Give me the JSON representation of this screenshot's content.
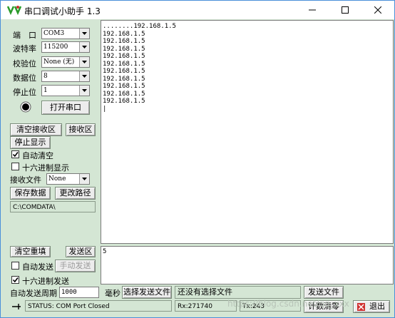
{
  "window": {
    "title": "串口调试小助手 1.3"
  },
  "port": {
    "port_label": "端　口",
    "port_value": "COM3",
    "baud_label": "波特率",
    "baud_value": "115200",
    "parity_label": "校验位",
    "parity_value": "None (无)",
    "data_label": "数据位",
    "data_value": "8",
    "stop_label": "停止位",
    "stop_value": "1",
    "open_button": "打开串口"
  },
  "receive": {
    "clear_button": "清空接收区",
    "area_label": "接收区",
    "stop_display_button": "停止显示",
    "auto_clear_label": "自动清空",
    "auto_clear_checked": true,
    "hex_display_label": "十六进制显示",
    "hex_display_checked": false,
    "file_label": "接收文件",
    "file_value": "None",
    "save_button": "保存数据",
    "change_path_button": "更改路径",
    "path": "C:\\COMDATA\\",
    "lines": [
      "........192.168.1.5",
      "192.168.1.5",
      "192.168.1.5",
      "192.168.1.5",
      "192.168.1.5",
      "192.168.1.5",
      "192.168.1.5",
      "192.168.1.5",
      "192.168.1.5",
      "192.168.1.5",
      "192.168.1.5",
      "|"
    ]
  },
  "send": {
    "clear_button": "清空重填",
    "area_label": "发送区",
    "auto_send_label": "自动发送",
    "auto_send_checked": false,
    "manual_send_button": "手动发送",
    "hex_send_label": "十六进制发送",
    "hex_send_checked": true,
    "period_label": "自动发送周期",
    "period_value": "1000",
    "ms_label": "毫秒",
    "select_file_button": "选择发送文件",
    "file_status": "还没有选择文件",
    "send_file_button": "发送文件",
    "content": "5"
  },
  "status": {
    "status_text": "STATUS: COM Port Closed",
    "rx_text": "Rx:271740",
    "tx_text": "Tx:243",
    "count_clear_button": "计数清零",
    "exit_button": "退出"
  },
  "watermark": "https://blog.csdn.net/qq_xxx",
  "colors": {
    "panel": "#d4e6d4",
    "accent": "#4a90d9"
  }
}
